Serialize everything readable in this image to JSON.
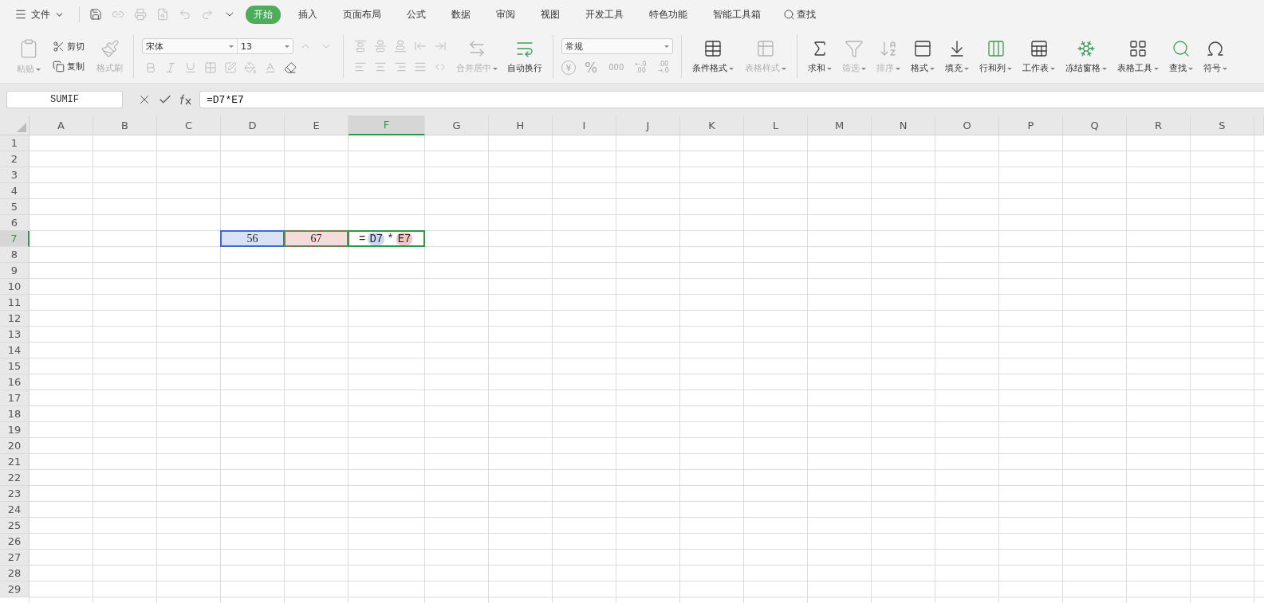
{
  "menu": {
    "file": "文件",
    "quick_access": [
      {
        "kind": "save",
        "disabled": false
      },
      {
        "kind": "link",
        "disabled": true
      },
      {
        "kind": "print",
        "disabled": true
      },
      {
        "kind": "preview",
        "disabled": true
      },
      {
        "kind": "undo",
        "disabled": true
      },
      {
        "kind": "redo",
        "disabled": true
      },
      {
        "kind": "more",
        "disabled": false
      }
    ],
    "tabs": [
      {
        "label": "开始",
        "selected": true
      },
      {
        "label": "插入",
        "selected": false
      },
      {
        "label": "页面布局",
        "selected": false
      },
      {
        "label": "公式",
        "selected": false
      },
      {
        "label": "数据",
        "selected": false
      },
      {
        "label": "审阅",
        "selected": false
      },
      {
        "label": "视图",
        "selected": false
      },
      {
        "label": "开发工具",
        "selected": false
      },
      {
        "label": "特色功能",
        "selected": false
      },
      {
        "label": "智能工具箱",
        "selected": false
      }
    ],
    "search": "查找"
  },
  "ribbon": {
    "clipboard": {
      "paste": {
        "label": "粘贴",
        "disabled": true
      },
      "cut": {
        "label": "剪切",
        "disabled": false
      },
      "copy": {
        "label": "复制",
        "disabled": false
      },
      "painter": {
        "label": "格式刷",
        "disabled": true
      }
    },
    "font": {
      "name": "宋体",
      "size": "13",
      "size_tools": [
        {
          "kind": "grow",
          "disabled": true
        },
        {
          "kind": "shrink",
          "disabled": true
        }
      ],
      "format_tools": [
        {
          "kind": "bold",
          "disabled": true
        },
        {
          "kind": "italic",
          "disabled": true
        },
        {
          "kind": "underline",
          "disabled": true
        },
        {
          "kind": "borders",
          "disabled": true
        },
        {
          "kind": "cell-style",
          "disabled": true
        },
        {
          "kind": "fill",
          "disabled": true
        },
        {
          "kind": "font-color",
          "disabled": true
        },
        {
          "kind": "clear",
          "disabled": false
        }
      ]
    },
    "alignment": {
      "top_tools": [
        {
          "kind": "top",
          "disabled": true
        },
        {
          "kind": "middle",
          "disabled": true
        },
        {
          "kind": "bottom",
          "disabled": true
        },
        {
          "kind": "outdent",
          "disabled": true
        },
        {
          "kind": "indent",
          "disabled": true
        }
      ],
      "bottom_tools": [
        {
          "kind": "left",
          "disabled": true
        },
        {
          "kind": "center",
          "disabled": true
        },
        {
          "kind": "right",
          "disabled": true
        },
        {
          "kind": "justify",
          "disabled": true
        },
        {
          "kind": "distribute",
          "disabled": true
        }
      ],
      "merge": {
        "label": "合并居中",
        "disabled": true
      },
      "wrap": {
        "label": "自动换行",
        "disabled": false
      }
    },
    "number": {
      "format": "常规",
      "buttons": [
        {
          "kind": "currency",
          "lines": [
            "¥"
          ],
          "disabled": true
        },
        {
          "kind": "percent",
          "lines": [
            "%"
          ],
          "disabled": true
        },
        {
          "kind": "thousands",
          "lines": [
            "000"
          ],
          "disabled": true
        },
        {
          "kind": "add-decimal",
          "lines": [
            "←.0",
            ".00"
          ],
          "disabled": true
        },
        {
          "kind": "remove-decimal",
          "lines": [
            ".00",
            "→.0"
          ],
          "disabled": true
        }
      ]
    },
    "styles": [
      {
        "kind": "conditional",
        "label": "条件格式",
        "disabled": false
      },
      {
        "kind": "table-style",
        "label": "表格样式",
        "disabled": true
      }
    ],
    "editing": [
      {
        "kind": "sum",
        "label": "求和",
        "disabled": false
      },
      {
        "kind": "filter",
        "label": "筛选",
        "disabled": true
      },
      {
        "kind": "sort",
        "label": "排序",
        "disabled": true
      },
      {
        "kind": "format",
        "label": "格式",
        "disabled": false
      },
      {
        "kind": "fill-down",
        "label": "填充",
        "disabled": false
      },
      {
        "kind": "rows-cols",
        "label": "行和列",
        "disabled": false
      },
      {
        "kind": "sheet",
        "label": "工作表",
        "disabled": false
      },
      {
        "kind": "freeze",
        "label": "冻结窗格",
        "disabled": false
      },
      {
        "kind": "table-tools",
        "label": "表格工具",
        "disabled": false
      },
      {
        "kind": "find",
        "label": "查找",
        "disabled": false
      },
      {
        "kind": "symbol",
        "label": "符号",
        "disabled": false
      }
    ]
  },
  "formula_bar": {
    "name_box": "SUMIF",
    "formula": "=D7*E7"
  },
  "sheet": {
    "columns": [
      {
        "label": "A",
        "selected": false
      },
      {
        "label": "B",
        "selected": false
      },
      {
        "label": "C",
        "selected": false
      },
      {
        "label": "D",
        "selected": false
      },
      {
        "label": "E",
        "selected": false
      },
      {
        "label": "F",
        "selected": true
      },
      {
        "label": "G",
        "selected": false
      },
      {
        "label": "H",
        "selected": false
      },
      {
        "label": "I",
        "selected": false
      },
      {
        "label": "J",
        "selected": false
      },
      {
        "label": "K",
        "selected": false
      },
      {
        "label": "L",
        "selected": false
      },
      {
        "label": "M",
        "selected": false
      },
      {
        "label": "N",
        "selected": false
      },
      {
        "label": "O",
        "selected": false
      },
      {
        "label": "P",
        "selected": false
      },
      {
        "label": "Q",
        "selected": false
      },
      {
        "label": "R",
        "selected": false
      },
      {
        "label": "S",
        "selected": false
      }
    ],
    "rows": [
      {
        "label": "1",
        "selected": false
      },
      {
        "label": "2",
        "selected": false
      },
      {
        "label": "3",
        "selected": false
      },
      {
        "label": "4",
        "selected": false
      },
      {
        "label": "5",
        "selected": false
      },
      {
        "label": "6",
        "selected": false
      },
      {
        "label": "7",
        "selected": true,
        "cells": [
          null,
          null,
          null,
          {
            "kind": "reference",
            "text": "56",
            "color": "#3d6ad6",
            "marquee": false
          },
          {
            "kind": "reference",
            "text": "67",
            "color": "#d24d4d",
            "marquee": true
          },
          {
            "kind": "editing",
            "tokens": [
              {
                "text": "=",
                "kind": "operator"
              },
              {
                "text": "D7",
                "kind": "reference",
                "color": "#cdd7f3"
              },
              {
                "text": "*",
                "kind": "operator"
              },
              {
                "text": "E7",
                "kind": "reference",
                "color": "#f1c6c6"
              }
            ]
          }
        ]
      },
      {
        "label": "8",
        "selected": false
      },
      {
        "label": "9",
        "selected": false
      },
      {
        "label": "10",
        "selected": false
      },
      {
        "label": "11",
        "selected": false
      },
      {
        "label": "12",
        "selected": false
      },
      {
        "label": "13",
        "selected": false
      },
      {
        "label": "14",
        "selected": false
      },
      {
        "label": "15",
        "selected": false
      },
      {
        "label": "16",
        "selected": false
      },
      {
        "label": "17",
        "selected": false
      },
      {
        "label": "18",
        "selected": false
      },
      {
        "label": "19",
        "selected": false
      },
      {
        "label": "20",
        "selected": false
      },
      {
        "label": "21",
        "selected": false
      },
      {
        "label": "22",
        "selected": false
      },
      {
        "label": "23",
        "selected": false
      },
      {
        "label": "24",
        "selected": false
      },
      {
        "label": "25",
        "selected": false
      },
      {
        "label": "26",
        "selected": false
      },
      {
        "label": "27",
        "selected": false
      },
      {
        "label": "28",
        "selected": false
      },
      {
        "label": "29",
        "selected": false
      }
    ]
  }
}
